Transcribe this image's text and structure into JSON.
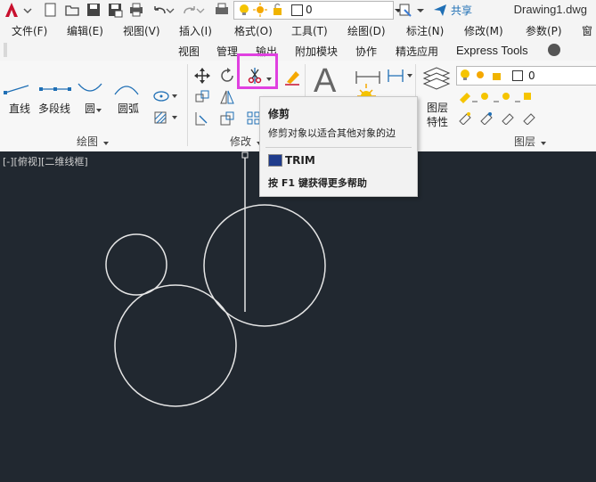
{
  "app": {
    "title": "Drawing1.dwg",
    "share_label": "共享",
    "layer_value": "0"
  },
  "menubar": [
    "文件(F)",
    "编辑(E)",
    "视图(V)",
    "插入(I)",
    "格式(O)",
    "工具(T)",
    "绘图(D)",
    "标注(N)",
    "修改(M)",
    "参数(P)",
    "窗"
  ],
  "ribbon_tabs": [
    "视图",
    "管理",
    "输出",
    "附加模块",
    "协作",
    "精选应用",
    "Express Tools"
  ],
  "draw_panel": {
    "title": "绘图",
    "tools": [
      "直线",
      "多段线",
      "圆",
      "圆弧"
    ]
  },
  "modify_panel": {
    "title": "修改"
  },
  "layers_panel": {
    "title": "图层",
    "properties_label_1": "图层",
    "properties_label_2": "特性",
    "layer_value": "0"
  },
  "annotation": {
    "big_text_icon": "A"
  },
  "viewport": {
    "label": "[-][俯视][二维线框]"
  },
  "tooltip": {
    "title": "修剪",
    "description": "修剪对象以适合其他对象的边",
    "command": "TRIM",
    "help": "按 F1 键获得更多帮助"
  },
  "colors": {
    "canvas_bg": "#212830",
    "highlight": "#e040e0",
    "accent_red": "#c8102e"
  }
}
